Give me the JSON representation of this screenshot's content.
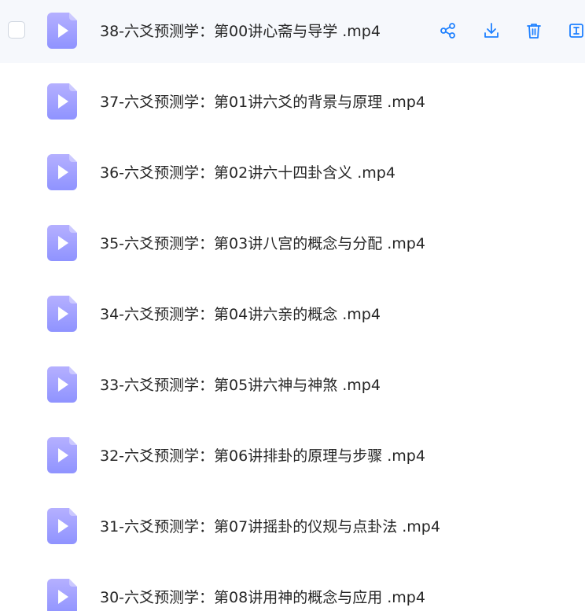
{
  "colors": {
    "accent": "#1e80ff",
    "file_icon_top": "#b5b0ff",
    "file_icon_bottom": "#8f93ff",
    "hover_row_bg": "#f6f8fc",
    "text": "#262626"
  },
  "file_icon_name": "video-file-icon",
  "actions": [
    {
      "name": "share-icon"
    },
    {
      "name": "download-icon"
    },
    {
      "name": "delete-icon"
    },
    {
      "name": "rename-icon"
    }
  ],
  "files": [
    {
      "name": "38-六爻预测学：第00讲心斋与导学 .mp4"
    },
    {
      "name": "37-六爻预测学：第01讲六爻的背景与原理 .mp4"
    },
    {
      "name": "36-六爻预测学：第02讲六十四卦含义 .mp4"
    },
    {
      "name": "35-六爻预测学：第03讲八宫的概念与分配 .mp4"
    },
    {
      "name": "34-六爻预测学：第04讲六亲的概念 .mp4"
    },
    {
      "name": "33-六爻预测学：第05讲六神与神煞 .mp4"
    },
    {
      "name": "32-六爻预测学：第06讲排卦的原理与步骤 .mp4"
    },
    {
      "name": "31-六爻预测学：第07讲摇卦的仪规与点卦法 .mp4"
    },
    {
      "name": "30-六爻预测学：第08讲用神的概念与应用 .mp4"
    }
  ]
}
